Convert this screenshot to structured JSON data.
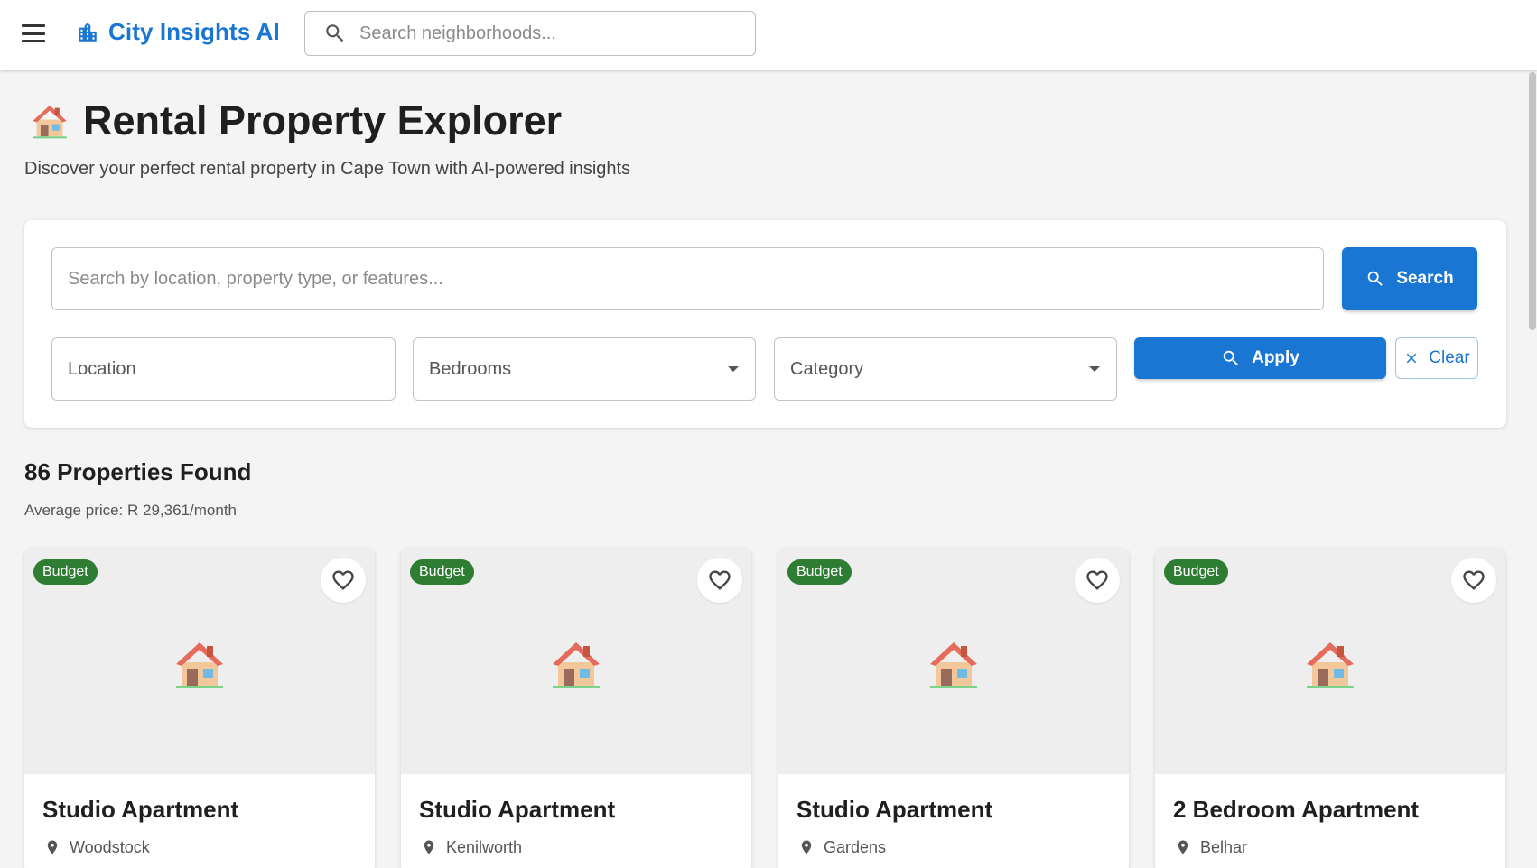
{
  "appbar": {
    "title": "City Insights AI",
    "search_placeholder": "Search neighborhoods...",
    "brand_color": "#1976d2"
  },
  "header": {
    "title": "Rental Property Explorer",
    "subtitle": "Discover your perfect rental property in Cape Town with AI-powered insights"
  },
  "search": {
    "placeholder": "Search by location, property type, or features...",
    "search_button": "Search",
    "location_placeholder": "Location",
    "bedrooms_label": "Bedrooms",
    "category_label": "Category",
    "apply_button": "Apply",
    "clear_button": "Clear"
  },
  "results": {
    "count_label": "86 Properties Found",
    "avg_price_label": "Average price: R 29,361/month"
  },
  "properties": [
    {
      "badge": "Budget",
      "title": "Studio Apartment",
      "location": "Woodstock"
    },
    {
      "badge": "Budget",
      "title": "Studio Apartment",
      "location": "Kenilworth"
    },
    {
      "badge": "Budget",
      "title": "Studio Apartment",
      "location": "Gardens"
    },
    {
      "badge": "Budget",
      "title": "2 Bedroom Apartment",
      "location": "Belhar"
    }
  ],
  "colors": {
    "primary": "#1976d2",
    "badge_budget": "#2e7d32",
    "background": "#f4f4f4"
  },
  "icons": {
    "menu": "menu-icon",
    "brand": "city-buildings-icon",
    "search": "search-icon",
    "house": "house-emoji-icon",
    "favorite": "heart-outline-icon",
    "location": "map-pin-icon",
    "clear": "close-icon",
    "dropdown": "caret-down-icon"
  }
}
